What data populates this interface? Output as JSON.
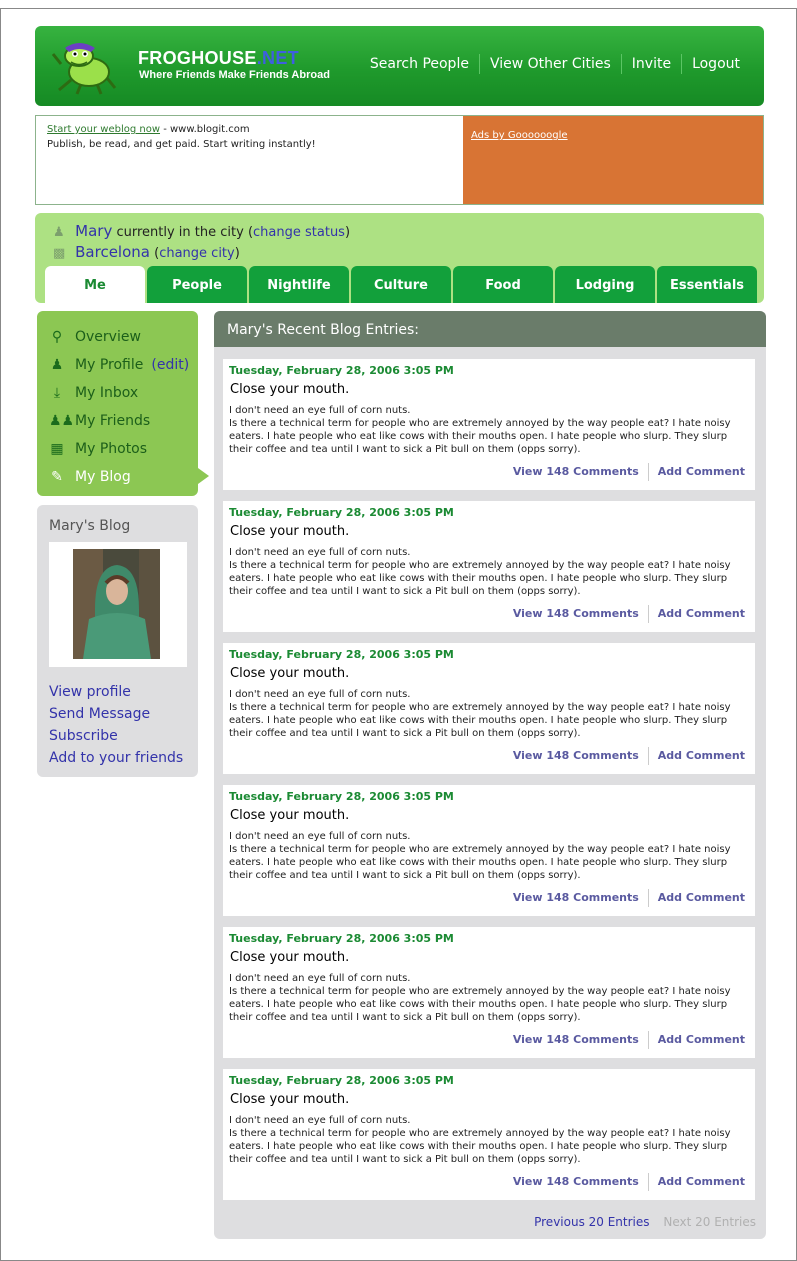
{
  "header": {
    "brand_main": "FROGHOUSE",
    "brand_suffix": ".NET",
    "tagline": "Where Friends Make Friends Abroad",
    "nav": [
      "Search People",
      "View Other Cities",
      "Invite",
      "Logout"
    ]
  },
  "ad": {
    "link_text": "Start your weblog now",
    "separator": " - ",
    "url_text": "www.blogit.com",
    "body": "Publish, be read, and get paid. Start writing instantly!",
    "ads_by": "Ads by Goooooogle",
    "ads_bg": "#d87434"
  },
  "status": {
    "user_name": "Mary",
    "status_text": "currently in the city",
    "change_status": "change status",
    "city": "Barcelona",
    "change_city": "change city"
  },
  "tabs": [
    "Me",
    "People",
    "Nightlife",
    "Culture",
    "Food",
    "Lodging",
    "Essentials"
  ],
  "side_menu": {
    "overview": "Overview",
    "profile": "My Profile",
    "edit": "edit",
    "inbox": "My Inbox",
    "friends": "My Friends",
    "photos": "My Photos",
    "blog": "My Blog"
  },
  "profile_box": {
    "title": "Mary's Blog",
    "links": [
      "View profile",
      "Send Message",
      "Subscribe",
      "Add to your friends"
    ]
  },
  "blog": {
    "heading": "Mary's Recent Blog Entries:",
    "entries": [
      {
        "date": "Tuesday, February 28, 2006 3:05 PM",
        "title": "Close your mouth.",
        "line1": "I don't need an eye full of corn nuts.",
        "body": "Is there a technical term for people who are extremely annoyed by the way people eat?  I hate noisy eaters. I hate people who eat like cows with their mouths open. I hate people who slurp. They slurp their coffee and tea until I want to sick a Pit bull on them (opps sorry).",
        "view_comments": "View 148 Comments",
        "add_comment": "Add Comment"
      },
      {
        "date": "Tuesday, February 28, 2006 3:05 PM",
        "title": "Close your mouth.",
        "line1": "I don't need an eye full of corn nuts.",
        "body": "Is there a technical term for people who are extremely annoyed by the way people eat?  I hate noisy eaters. I hate people who eat like cows with their mouths open. I hate people who slurp. They slurp their coffee and tea until I want to sick a Pit bull on them (opps sorry).",
        "view_comments": "View 148 Comments",
        "add_comment": "Add Comment"
      },
      {
        "date": "Tuesday, February 28, 2006 3:05 PM",
        "title": "Close your mouth.",
        "line1": "I don't need an eye full of corn nuts.",
        "body": "Is there a technical term for people who are extremely annoyed by the way people eat?  I hate noisy eaters. I hate people who eat like cows with their mouths open. I hate people who slurp. They slurp their coffee and tea until I want to sick a Pit bull on them (opps sorry).",
        "view_comments": "View 148 Comments",
        "add_comment": "Add Comment"
      },
      {
        "date": "Tuesday, February 28, 2006 3:05 PM",
        "title": "Close your mouth.",
        "line1": "I don't need an eye full of corn nuts.",
        "body": "Is there a technical term for people who are extremely annoyed by the way people eat?  I hate noisy eaters. I hate people who eat like cows with their mouths open. I hate people who slurp. They slurp their coffee and tea until I want to sick a Pit bull on them (opps sorry).",
        "view_comments": "View 148 Comments",
        "add_comment": "Add Comment"
      },
      {
        "date": "Tuesday, February 28, 2006 3:05 PM",
        "title": "Close your mouth.",
        "line1": "I don't need an eye full of corn nuts.",
        "body": "Is there a technical term for people who are extremely annoyed by the way people eat?  I hate noisy eaters. I hate people who eat like cows with their mouths open. I hate people who slurp. They slurp their coffee and tea until I want to sick a Pit bull on them (opps sorry).",
        "view_comments": "View 148 Comments",
        "add_comment": "Add Comment"
      },
      {
        "date": "Tuesday, February 28, 2006 3:05 PM",
        "title": "Close your mouth.",
        "line1": "I don't need an eye full of corn nuts.",
        "body": "Is there a technical term for people who are extremely annoyed by the way people eat?  I hate noisy eaters. I hate people who eat like cows with their mouths open. I hate people who slurp. They slurp their coffee and tea until I want to sick a Pit bull on them (opps sorry).",
        "view_comments": "View 148 Comments",
        "add_comment": "Add Comment"
      }
    ],
    "prev": "Previous 20 Entries",
    "next": "Next 20 Entries"
  },
  "colors": {
    "header_green": "#1f9a2c",
    "tab_green": "#12a03b",
    "light_green": "#ade183",
    "menu_green": "#8cc753",
    "link_blue": "#3333aa"
  }
}
